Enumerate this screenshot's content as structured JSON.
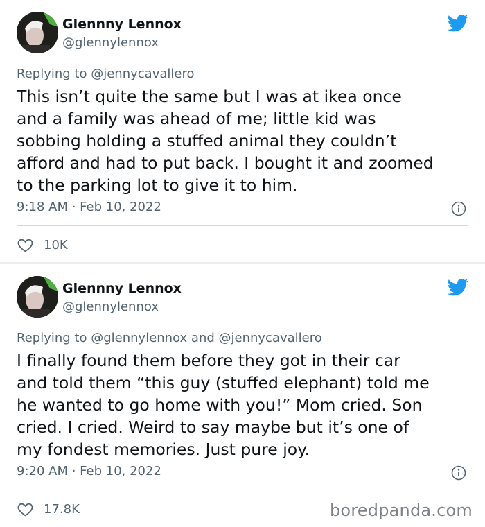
{
  "tweets": [
    {
      "author_name": "Glennny Lennox",
      "handle": "@glennylennox",
      "replying_prefix": "Replying to",
      "replying_to": "@jennycavallero",
      "body_lines": [
        "This isn’t quite the same but I was at ikea once",
        "and a family was ahead of me; little kid was",
        "sobbing holding a stuffed animal they couldn’t",
        "afford and had to put back. I bought it and zoomed",
        "to the parking lot to give it to him."
      ],
      "time": "9:18 AM · Feb 10, 2022",
      "likes": "10K"
    },
    {
      "author_name": "Glennny Lennox",
      "handle": "@glennylennox",
      "replying_prefix": "Replying to",
      "replying_to": "@glennylennox and @jennycavallero",
      "body_lines": [
        "I finally found them before they got in their car",
        "and told them “this guy (stuffed elephant) told me",
        "he wanted to go home with you!” Mom cried. Son",
        "cried. I cried. Weird to say maybe but it’s one of",
        "my fondest memories. Just pure joy."
      ],
      "time": "9:20 AM · Feb 10, 2022",
      "likes": "17.8K"
    }
  ],
  "watermark": "boredpanda.com",
  "colors": {
    "twitter_blue": "#1d9bf0",
    "text_primary": "#0f1419",
    "text_secondary": "#536471",
    "divider": "#cfd9de"
  },
  "icons": [
    "twitter-bird-icon",
    "info-icon",
    "heart-icon"
  ]
}
